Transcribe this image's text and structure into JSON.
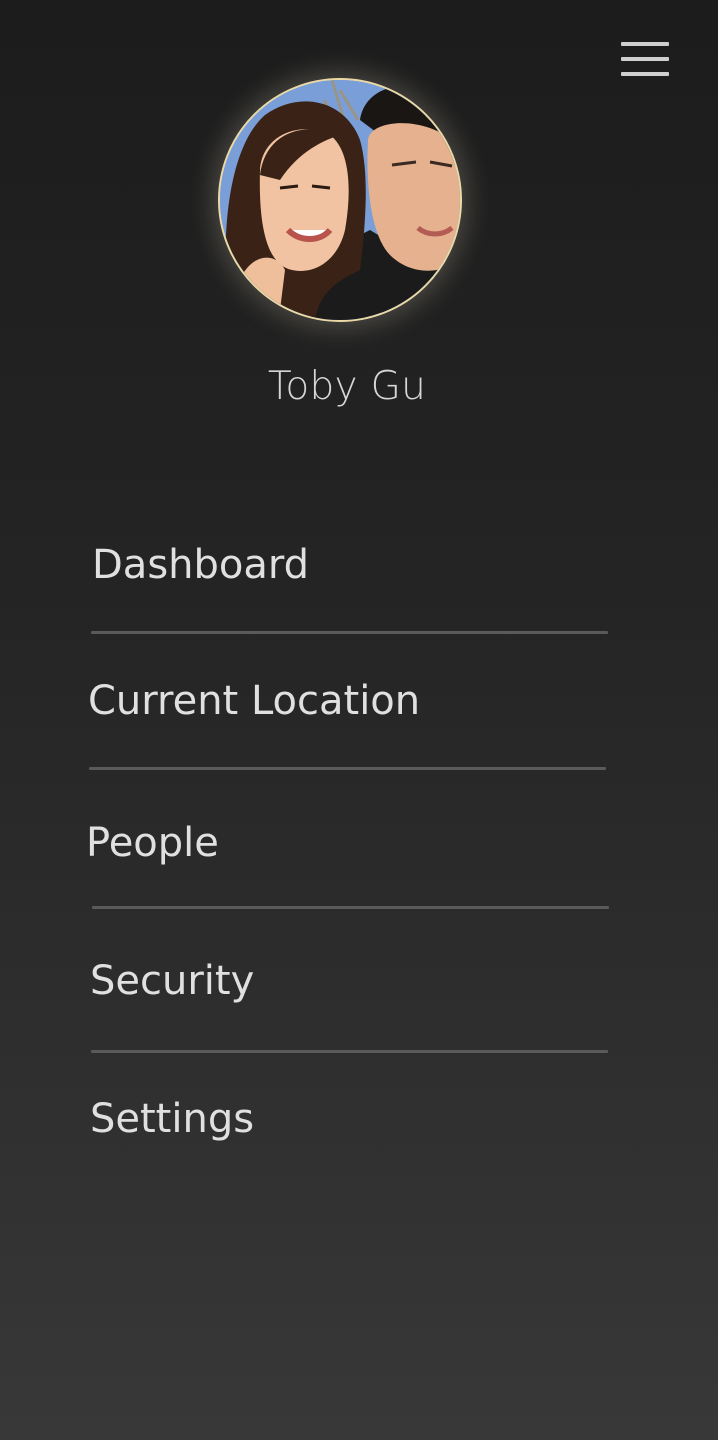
{
  "header": {
    "menu_icon": "hamburger-menu-icon"
  },
  "profile": {
    "name": "Toby Gu",
    "avatar_description": "photo-avatar"
  },
  "nav": {
    "items": [
      {
        "label": "Dashboard"
      },
      {
        "label": "Current Location"
      },
      {
        "label": "People"
      },
      {
        "label": "Security"
      },
      {
        "label": "Settings"
      }
    ]
  },
  "colors": {
    "background_top": "#1c1c1c",
    "background_bottom": "#383838",
    "text": "#e0e0e0",
    "divider": "#5a5a5a",
    "avatar_ring": "#ead9a6"
  }
}
